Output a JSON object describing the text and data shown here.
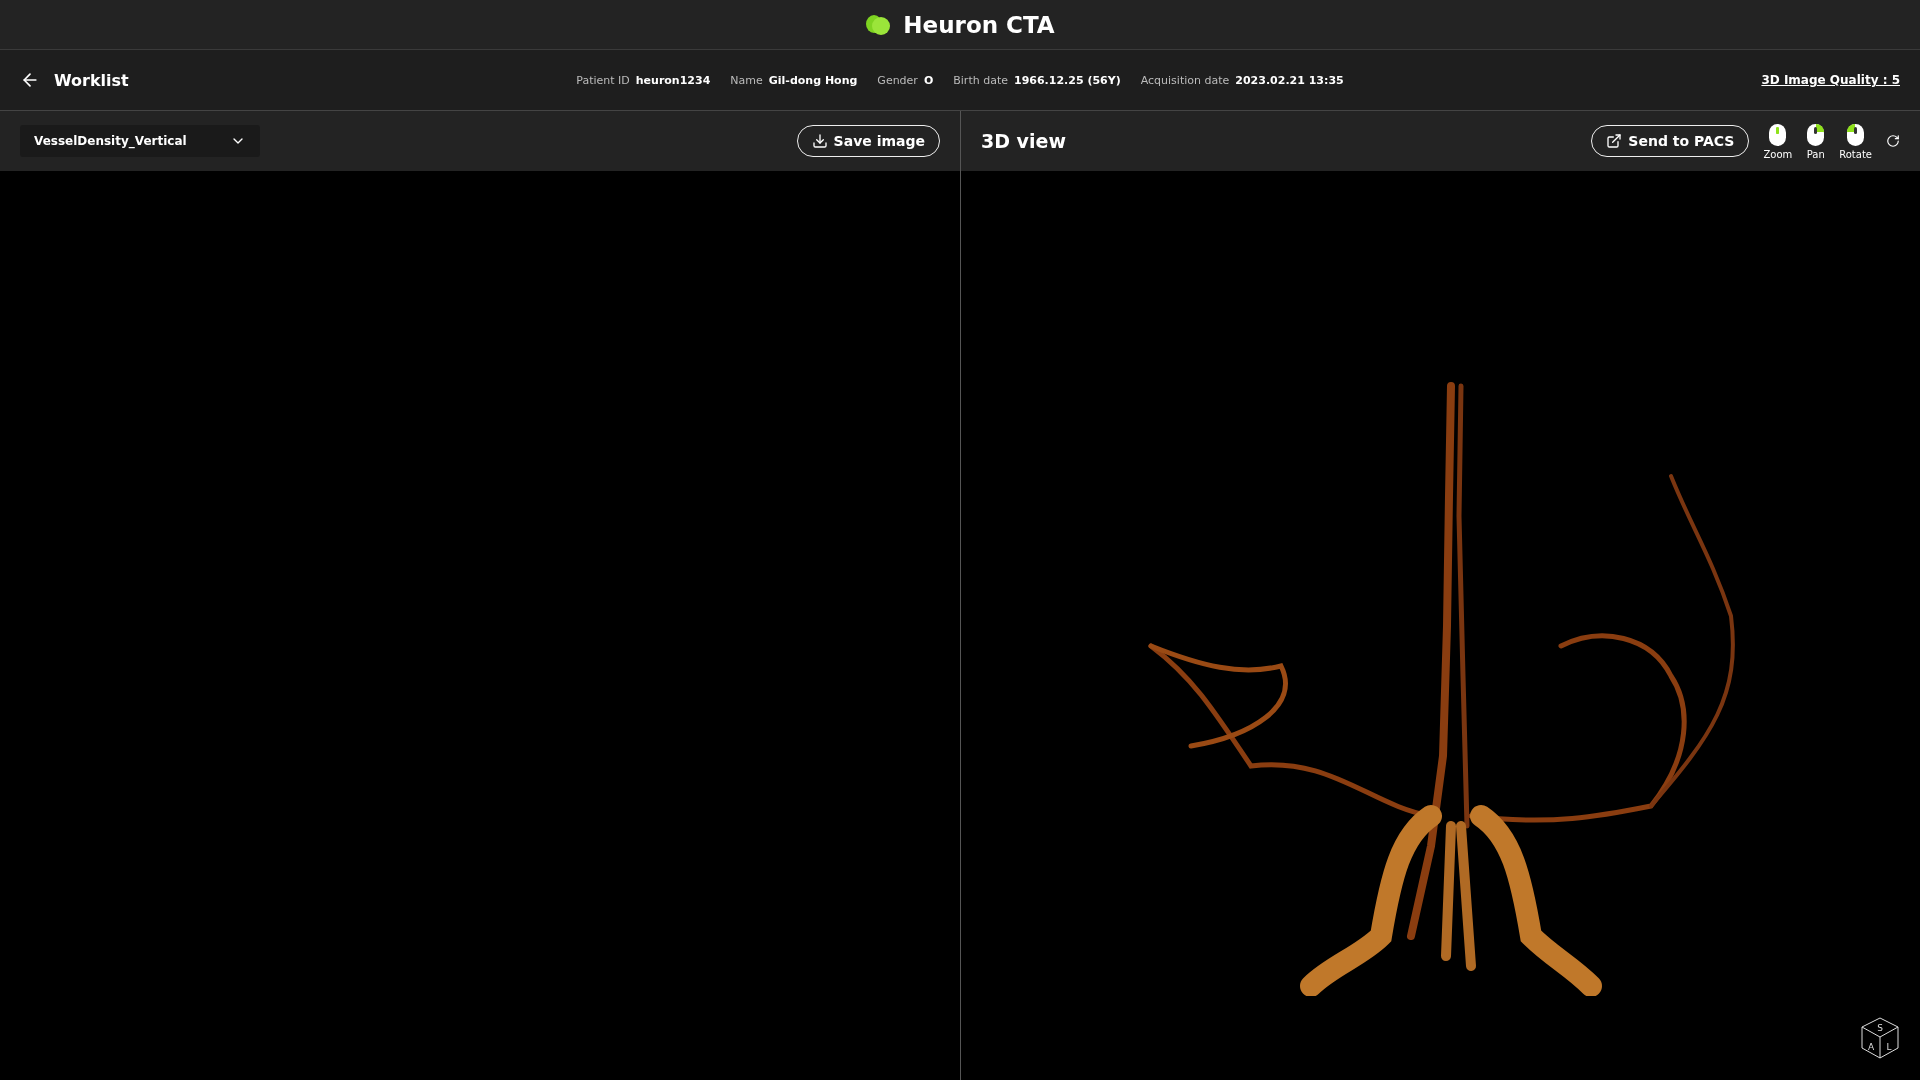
{
  "app": {
    "title": "Heuron CTA"
  },
  "infobar": {
    "back_label": "Worklist",
    "fields": [
      {
        "label": "Patient ID",
        "value": "heuron1234"
      },
      {
        "label": "Name",
        "value": "Gil-dong Hong"
      },
      {
        "label": "Gender",
        "value": "O"
      },
      {
        "label": "Birth date",
        "value": "1966.12.25 (56Y)"
      },
      {
        "label": "Acquisition date",
        "value": "2023.02.21 13:35"
      }
    ],
    "quality_link": "3D Image Quality : 5"
  },
  "left_panel": {
    "dropdown": {
      "value": "VesselDensity_Vertical"
    },
    "save_button": "Save image"
  },
  "right_panel": {
    "title": "3D view",
    "send_button": "Send to PACS",
    "tools": [
      {
        "kind": "wheel",
        "label": "Zoom"
      },
      {
        "kind": "right",
        "label": "Pan"
      },
      {
        "kind": "left",
        "label": "Rotate"
      }
    ],
    "orientation_cube": {
      "top": "S",
      "front": "A",
      "side": "L"
    }
  }
}
